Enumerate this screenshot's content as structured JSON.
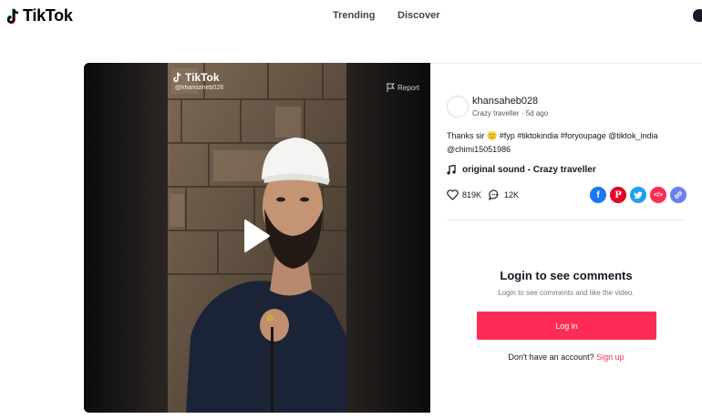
{
  "header": {
    "logo_text": "TikTok",
    "nav": {
      "trending": "Trending",
      "discover": "Discover"
    }
  },
  "video": {
    "watermark_logo": "TikTok",
    "watermark_user": "@khansaheb028",
    "report_label": "Report",
    "play_icon": "play-icon"
  },
  "post": {
    "username": "khansaheb028",
    "display_name": "Crazy traveller",
    "separator": "·",
    "posted": "5d ago",
    "caption_line1": "Thanks sir 🙂 #fyp #tiktokindia #foryoupage @tiktok_india",
    "caption_line2": "@chimi15051986",
    "sound": "original sound - Crazy traveller",
    "likes": "819K",
    "comments": "12K",
    "share_targets": [
      "Facebook",
      "Pinterest",
      "Twitter",
      "Embed",
      "Copy link"
    ],
    "colors": {
      "facebook": "#1877f2",
      "pinterest": "#e60023",
      "twitter": "#1da1f2",
      "embed": "#fe2c55",
      "copy": "#6c7ef0"
    }
  },
  "comments_gate": {
    "title": "Login to see comments",
    "subtitle": "Login to see comments and like the video.",
    "login_button": "Log in",
    "no_account": "Don't have an account?",
    "signup_link": "Sign up"
  },
  "accent_color": "#fe2c55"
}
